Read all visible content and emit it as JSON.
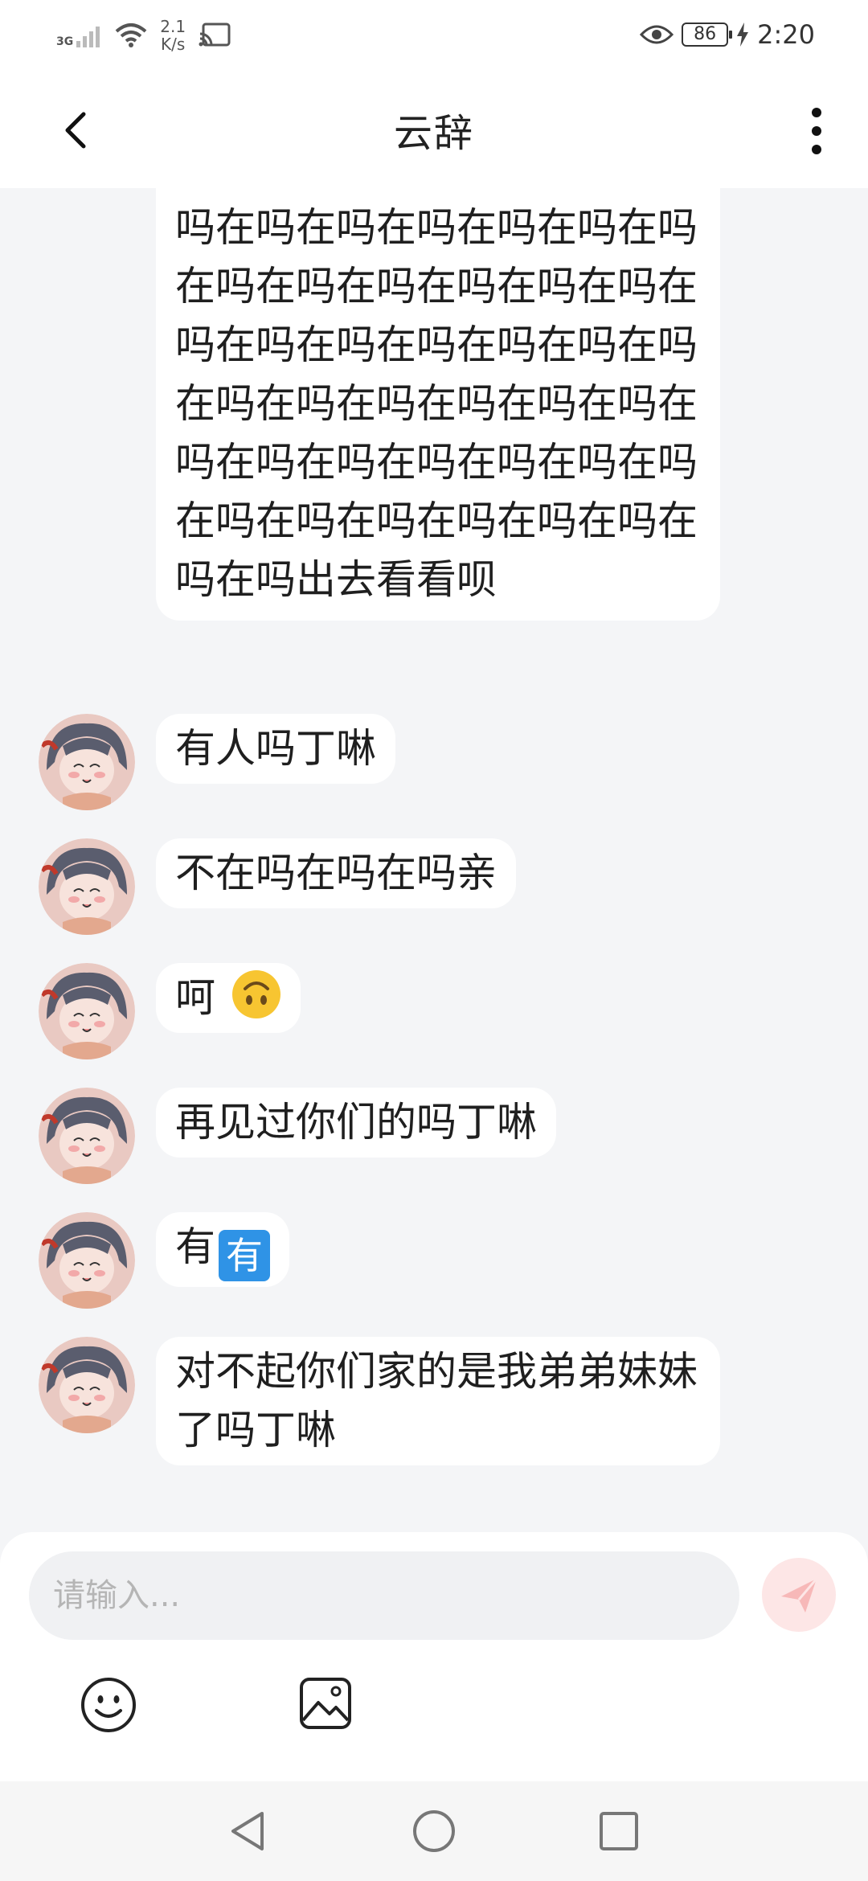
{
  "status_bar": {
    "network": "3G",
    "speed_value": "2.1",
    "speed_unit": "K/s",
    "battery": "86",
    "time": "2:20"
  },
  "header": {
    "title": "云辞"
  },
  "messages": [
    {
      "text": "在吗在吗在吗在吗在吗在吗在吗在吗在吗在吗在吗在吗在吗在吗在吗在吗在吗在吗在吗在吗在吗在吗在吗在吗在吗在吗在吗在吗在吗在吗在吗在吗在吗在吗在吗在吗在吗在吗在吗在吗在吗在吗在吗在吗在吗在吗在吗出去看看呗"
    },
    {
      "text": "有人吗丁啉"
    },
    {
      "text": "不在吗在吗在吗亲"
    },
    {
      "text": "呵"
    },
    {
      "text": "再见过你们的吗丁啉"
    },
    {
      "text": "有",
      "badge": "有"
    },
    {
      "text": "对不起你们家的是我弟弟妹妹了吗丁啉"
    }
  ],
  "composer": {
    "placeholder": "请输入..."
  },
  "icons": {
    "back": "chevron-left-icon",
    "more": "more-vertical-icon",
    "send": "paper-plane-icon",
    "emoji": "smiley-icon",
    "image": "image-icon",
    "upside_down_face": "upside-down-face-emoji"
  },
  "colors": {
    "background": "#f4f5f7",
    "bubble": "#ffffff",
    "send_button": "#fde6e6",
    "badge": "#2f93e6"
  }
}
